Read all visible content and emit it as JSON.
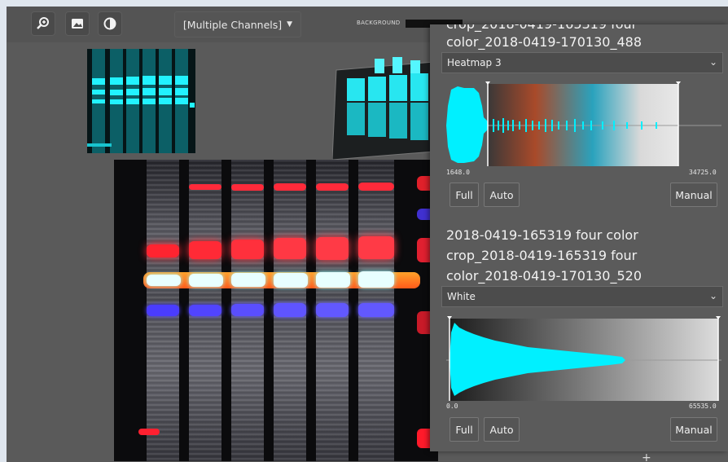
{
  "toolbar": {
    "zoom_icon": "zoom-in-icon",
    "image_icon": "image-icon",
    "contrast_icon": "contrast-icon",
    "channel_select": "[Multiple Channels]",
    "background_label": "BACKGROUND"
  },
  "panel": {
    "channel1": {
      "title_line1": "crop_2018-0419-165319 four",
      "title_line2": "color_2018-0419-170130_488",
      "colormap": "Heatmap 3",
      "range_min": "1648.0",
      "range_max": "34725.0",
      "btn_full": "Full",
      "btn_auto": "Auto",
      "btn_manual": "Manual"
    },
    "channel2": {
      "title_line1": "2018-0419-165319 four color",
      "title_line2": "crop_2018-0419-165319 four",
      "title_line3": "color_2018-0419-170130_520",
      "colormap": "White",
      "range_min": "0.0",
      "range_max": "65535.0",
      "btn_full": "Full",
      "btn_auto": "Auto",
      "btn_manual": "Manual"
    }
  },
  "footer": {
    "add_label": "+"
  },
  "colors": {
    "histogram": "#00f0ff",
    "panel_bg": "#5b5b5b",
    "app_bg": "#535353"
  }
}
